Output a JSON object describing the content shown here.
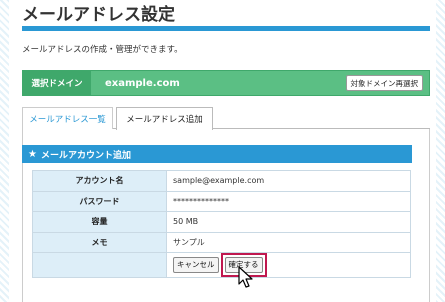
{
  "page": {
    "title": "メールアドレス設定",
    "description": "メールアドレスの作成・管理ができます。"
  },
  "domain": {
    "label": "選択ドメイン",
    "value": "example.com",
    "reselect_label": "対象ドメイン再選択"
  },
  "tabs": [
    {
      "label": "メールアドレス一覧",
      "active": false
    },
    {
      "label": "メールアドレス追加",
      "active": true
    }
  ],
  "section": {
    "title": "メールアカウント追加",
    "icon": "star-icon"
  },
  "form": {
    "rows": [
      {
        "label": "アカウント名",
        "value": "sample@example.com"
      },
      {
        "label": "パスワード",
        "value": "**************"
      },
      {
        "label": "容量",
        "value": "50 MB"
      },
      {
        "label": "メモ",
        "value": "サンプル"
      }
    ],
    "cancel_label": "キャンセル",
    "confirm_label": "確定する"
  },
  "colors": {
    "accent": "#2a98d4",
    "domain_bar": "#5bbf84",
    "highlight": "#c0184f"
  }
}
